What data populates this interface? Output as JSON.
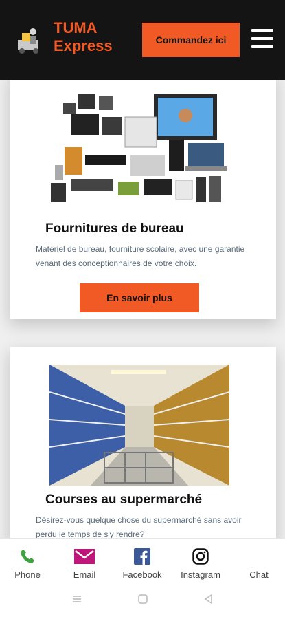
{
  "header": {
    "brand_line1": "TUMA",
    "brand_line2": "Express",
    "order_label": "Commandez ici",
    "menu_icon": "hamburger-menu-icon",
    "accent": "#f15a24",
    "background": "#141414"
  },
  "cards": [
    {
      "title": "Fournitures de bureau",
      "description": "Matériel de bureau, fourniture scolaire, avec une garantie venant des conceptionnaires de votre choix.",
      "button": "En savoir plus"
    },
    {
      "title": "Courses au supermarché",
      "description": "Désirez-vous quelque chose du supermarché sans avoir perdu le temps de s'y rendre?"
    }
  ],
  "bottom_nav": [
    {
      "label": "Phone",
      "icon": "phone-icon"
    },
    {
      "label": "Email",
      "icon": "email-icon"
    },
    {
      "label": "Facebook",
      "icon": "facebook-icon"
    },
    {
      "label": "Instagram",
      "icon": "instagram-icon"
    },
    {
      "label": "Chat",
      "icon": "chat-icon"
    }
  ]
}
